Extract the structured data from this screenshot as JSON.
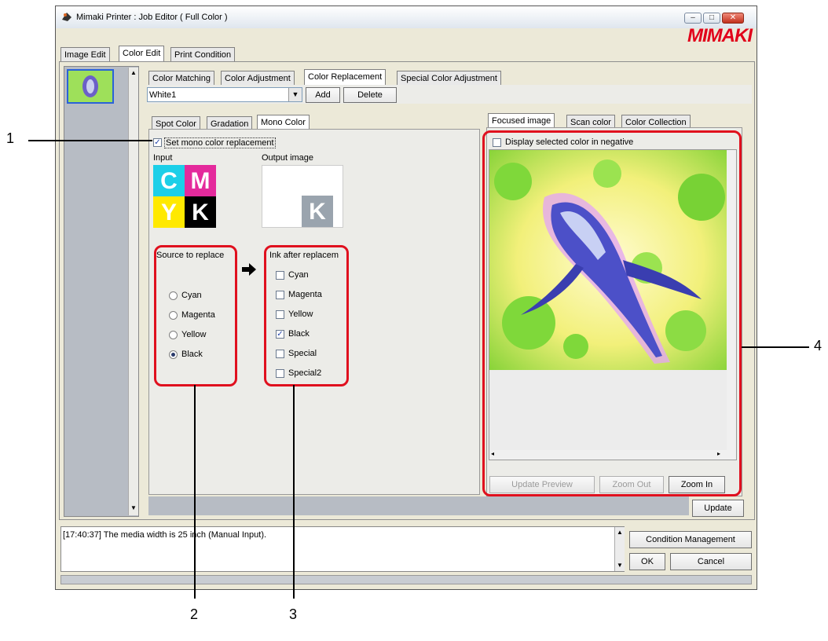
{
  "window": {
    "title": "Mimaki Printer : Job Editor ( Full Color )",
    "logo": "MIMAKI",
    "controls": [
      "–",
      "□",
      "✕"
    ]
  },
  "main_tabs": [
    "Image Edit",
    "Color Edit",
    "Print Condition"
  ],
  "sub_tabs": [
    "Color Matching",
    "Color Adjustment",
    "Color Replacement",
    "Special Color Adjustment"
  ],
  "replacement": {
    "selected": "White1",
    "add_label": "Add",
    "delete_label": "Delete"
  },
  "replace_tabs": [
    "Spot Color",
    "Gradation",
    "Mono Color"
  ],
  "mono": {
    "set_label": "Set mono color replacement",
    "input_label": "Input",
    "output_label": "Output image",
    "cmyk": [
      "C",
      "M",
      "Y",
      "K"
    ],
    "output_k": "K",
    "source_title": "Source to replace",
    "sources": [
      "Cyan",
      "Magenta",
      "Yellow",
      "Black"
    ],
    "ink_title": "Ink after replacem",
    "inks": [
      "Cyan",
      "Magenta",
      "Yellow",
      "Black",
      "Special",
      "Special2"
    ]
  },
  "preview_tabs": [
    "Focused image",
    "Scan color",
    "Color Collection"
  ],
  "preview": {
    "negative_label": "Display selected color in negative",
    "update_preview": "Update Preview",
    "zoom_out": "Zoom Out",
    "zoom_in": "Zoom In"
  },
  "update_label": "Update",
  "log_text": "[17:40:37] The media width is 25 inch (Manual Input).",
  "footer": {
    "condition_management": "Condition Management",
    "ok": "OK",
    "cancel": "Cancel"
  },
  "callouts": [
    "1",
    "2",
    "3",
    "4"
  ],
  "colors": {
    "highlight": "#e0101e",
    "cyan": "#1ccfe8",
    "magenta": "#e42a9c",
    "yellow": "#ffe900",
    "black": "#000000"
  }
}
